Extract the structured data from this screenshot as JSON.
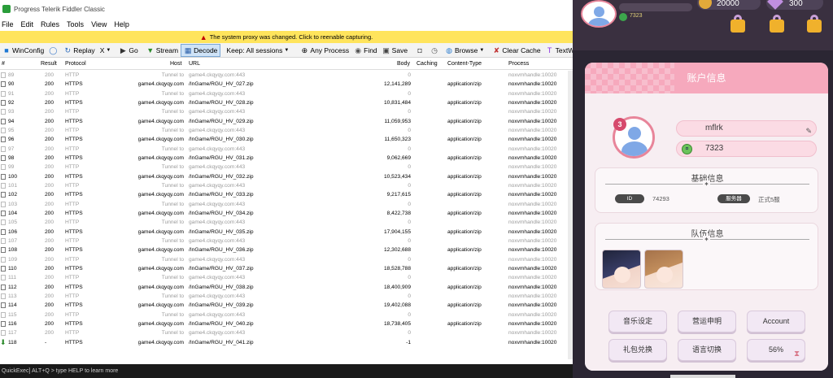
{
  "fiddler": {
    "title": "Progress Telerik Fiddler Classic",
    "menu": [
      "File",
      "Edit",
      "Rules",
      "Tools",
      "View",
      "Help"
    ],
    "notice": "The system proxy was changed. Click to reenable capturing.",
    "toolbar": {
      "winconfig": "WinConfig",
      "replay": "Replay",
      "remove": "X",
      "go": "Go",
      "stream": "Stream",
      "decode": "Decode",
      "keep": "Keep: All sessions",
      "any_process": "Any Process",
      "find": "Find",
      "save": "Save",
      "browse": "Browse",
      "clear_cache": "Clear Cache",
      "textwizard": "TextWizard"
    },
    "columns": {
      "num": "#",
      "result": "Result",
      "protocol": "Protocol",
      "host": "Host",
      "url": "URL",
      "body": "Body",
      "caching": "Caching",
      "content_type": "Content-Type",
      "process": "Process"
    },
    "rows": [
      {
        "num": "89",
        "result": "200",
        "protocol": "HTTP",
        "host": "Tunnel to",
        "url": "game4.ckqyqy.com:443",
        "body": "0",
        "ctype": "",
        "process": "noxvmhandle:10020",
        "tunnel": true
      },
      {
        "num": "90",
        "result": "200",
        "protocol": "HTTPS",
        "host": "game4.ckqyqy.com",
        "url": "/InGame/RGU_HV_027.zip",
        "body": "12,141,289",
        "ctype": "application/zip",
        "process": "noxvmhandle:10020",
        "tunnel": false
      },
      {
        "num": "91",
        "result": "200",
        "protocol": "HTTP",
        "host": "Tunnel to",
        "url": "game4.ckqyqy.com:443",
        "body": "0",
        "ctype": "",
        "process": "noxvmhandle:10020",
        "tunnel": true
      },
      {
        "num": "92",
        "result": "200",
        "protocol": "HTTPS",
        "host": "game4.ckqyqy.com",
        "url": "/InGame/RGU_HV_028.zip",
        "body": "10,831,484",
        "ctype": "application/zip",
        "process": "noxvmhandle:10020",
        "tunnel": false
      },
      {
        "num": "93",
        "result": "200",
        "protocol": "HTTP",
        "host": "Tunnel to",
        "url": "game4.ckqyqy.com:443",
        "body": "0",
        "ctype": "",
        "process": "noxvmhandle:10020",
        "tunnel": true
      },
      {
        "num": "94",
        "result": "200",
        "protocol": "HTTPS",
        "host": "game4.ckqyqy.com",
        "url": "/InGame/RGU_HV_029.zip",
        "body": "11,059,953",
        "ctype": "application/zip",
        "process": "noxvmhandle:10020",
        "tunnel": false
      },
      {
        "num": "95",
        "result": "200",
        "protocol": "HTTP",
        "host": "Tunnel to",
        "url": "game4.ckqyqy.com:443",
        "body": "0",
        "ctype": "",
        "process": "noxvmhandle:10020",
        "tunnel": true
      },
      {
        "num": "96",
        "result": "200",
        "protocol": "HTTPS",
        "host": "game4.ckqyqy.com",
        "url": "/InGame/RGU_HV_030.zip",
        "body": "11,650,323",
        "ctype": "application/zip",
        "process": "noxvmhandle:10020",
        "tunnel": false
      },
      {
        "num": "97",
        "result": "200",
        "protocol": "HTTP",
        "host": "Tunnel to",
        "url": "game4.ckqyqy.com:443",
        "body": "0",
        "ctype": "",
        "process": "noxvmhandle:10020",
        "tunnel": true
      },
      {
        "num": "98",
        "result": "200",
        "protocol": "HTTPS",
        "host": "game4.ckqyqy.com",
        "url": "/InGame/RGU_HV_031.zip",
        "body": "9,062,669",
        "ctype": "application/zip",
        "process": "noxvmhandle:10020",
        "tunnel": false
      },
      {
        "num": "99",
        "result": "200",
        "protocol": "HTTP",
        "host": "Tunnel to",
        "url": "game4.ckqyqy.com:443",
        "body": "0",
        "ctype": "",
        "process": "noxvmhandle:10020",
        "tunnel": true
      },
      {
        "num": "100",
        "result": "200",
        "protocol": "HTTPS",
        "host": "game4.ckqyqy.com",
        "url": "/InGame/RGU_HV_032.zip",
        "body": "10,523,434",
        "ctype": "application/zip",
        "process": "noxvmhandle:10020",
        "tunnel": false
      },
      {
        "num": "101",
        "result": "200",
        "protocol": "HTTP",
        "host": "Tunnel to",
        "url": "game4.ckqyqy.com:443",
        "body": "0",
        "ctype": "",
        "process": "noxvmhandle:10020",
        "tunnel": true
      },
      {
        "num": "102",
        "result": "200",
        "protocol": "HTTPS",
        "host": "game4.ckqyqy.com",
        "url": "/InGame/RGU_HV_033.zip",
        "body": "9,217,615",
        "ctype": "application/zip",
        "process": "noxvmhandle:10020",
        "tunnel": false
      },
      {
        "num": "103",
        "result": "200",
        "protocol": "HTTP",
        "host": "Tunnel to",
        "url": "game4.ckqyqy.com:443",
        "body": "0",
        "ctype": "",
        "process": "noxvmhandle:10020",
        "tunnel": true
      },
      {
        "num": "104",
        "result": "200",
        "protocol": "HTTPS",
        "host": "game4.ckqyqy.com",
        "url": "/InGame/RGU_HV_034.zip",
        "body": "8,422,738",
        "ctype": "application/zip",
        "process": "noxvmhandle:10020",
        "tunnel": false
      },
      {
        "num": "105",
        "result": "200",
        "protocol": "HTTP",
        "host": "Tunnel to",
        "url": "game4.ckqyqy.com:443",
        "body": "0",
        "ctype": "",
        "process": "noxvmhandle:10020",
        "tunnel": true
      },
      {
        "num": "106",
        "result": "200",
        "protocol": "HTTPS",
        "host": "game4.ckqyqy.com",
        "url": "/InGame/RGU_HV_035.zip",
        "body": "17,904,155",
        "ctype": "application/zip",
        "process": "noxvmhandle:10020",
        "tunnel": false
      },
      {
        "num": "107",
        "result": "200",
        "protocol": "HTTP",
        "host": "Tunnel to",
        "url": "game4.ckqyqy.com:443",
        "body": "0",
        "ctype": "",
        "process": "noxvmhandle:10020",
        "tunnel": true
      },
      {
        "num": "108",
        "result": "200",
        "protocol": "HTTPS",
        "host": "game4.ckqyqy.com",
        "url": "/InGame/RGU_HV_036.zip",
        "body": "12,302,688",
        "ctype": "application/zip",
        "process": "noxvmhandle:10020",
        "tunnel": false
      },
      {
        "num": "109",
        "result": "200",
        "protocol": "HTTP",
        "host": "Tunnel to",
        "url": "game4.ckqyqy.com:443",
        "body": "0",
        "ctype": "",
        "process": "noxvmhandle:10020",
        "tunnel": true
      },
      {
        "num": "110",
        "result": "200",
        "protocol": "HTTPS",
        "host": "game4.ckqyqy.com",
        "url": "/InGame/RGU_HV_037.zip",
        "body": "18,528,788",
        "ctype": "application/zip",
        "process": "noxvmhandle:10020",
        "tunnel": false
      },
      {
        "num": "111",
        "result": "200",
        "protocol": "HTTP",
        "host": "Tunnel to",
        "url": "game4.ckqyqy.com:443",
        "body": "0",
        "ctype": "",
        "process": "noxvmhandle:10020",
        "tunnel": true
      },
      {
        "num": "112",
        "result": "200",
        "protocol": "HTTPS",
        "host": "game4.ckqyqy.com",
        "url": "/InGame/RGU_HV_038.zip",
        "body": "18,400,909",
        "ctype": "application/zip",
        "process": "noxvmhandle:10020",
        "tunnel": false
      },
      {
        "num": "113",
        "result": "200",
        "protocol": "HTTP",
        "host": "Tunnel to",
        "url": "game4.ckqyqy.com:443",
        "body": "0",
        "ctype": "",
        "process": "noxvmhandle:10020",
        "tunnel": true
      },
      {
        "num": "114",
        "result": "200",
        "protocol": "HTTPS",
        "host": "game4.ckqyqy.com",
        "url": "/InGame/RGU_HV_039.zip",
        "body": "19,402,088",
        "ctype": "application/zip",
        "process": "noxvmhandle:10020",
        "tunnel": false
      },
      {
        "num": "115",
        "result": "200",
        "protocol": "HTTP",
        "host": "Tunnel to",
        "url": "game4.ckqyqy.com:443",
        "body": "0",
        "ctype": "",
        "process": "noxvmhandle:10020",
        "tunnel": true
      },
      {
        "num": "116",
        "result": "200",
        "protocol": "HTTPS",
        "host": "game4.ckqyqy.com",
        "url": "/InGame/RGU_HV_040.zip",
        "body": "18,738,405",
        "ctype": "application/zip",
        "process": "noxvmhandle:10020",
        "tunnel": false
      },
      {
        "num": "117",
        "result": "200",
        "protocol": "HTTP",
        "host": "Tunnel to",
        "url": "game4.ckqyqy.com:443",
        "body": "0",
        "ctype": "",
        "process": "noxvmhandle:10020",
        "tunnel": true
      },
      {
        "num": "118",
        "result": "-",
        "protocol": "HTTPS",
        "host": "game4.ckqyqy.com",
        "url": "/InGame/RGU_HV_041.zip",
        "body": "-1",
        "ctype": "",
        "process": "noxvmhandle:10020",
        "tunnel": false,
        "downloading": true
      }
    ],
    "status": "QuickExec] ALT+Q > type HELP to learn more"
  },
  "game": {
    "top": {
      "gold": "20000",
      "gems": "300",
      "small_coins": "7323"
    },
    "modal": {
      "title": "账户信息",
      "badge": "3",
      "username": "mflrk",
      "coins": "7323",
      "basic": {
        "title": "基础信息",
        "id_label": "ID",
        "id_value": "74293",
        "server_label": "服务器",
        "server_value": "正式5服"
      },
      "team": {
        "title": "队伍信息"
      },
      "buttons": {
        "music": "音乐设定",
        "ops": "营运申明",
        "account": "Account",
        "gift": "礼包兑换",
        "lang": "语言切换",
        "percent": "56%"
      }
    }
  },
  "colors": {
    "notice_bg": "#ffe45c",
    "modal_header": "#f6a9bd",
    "badge": "#d64a6d"
  }
}
